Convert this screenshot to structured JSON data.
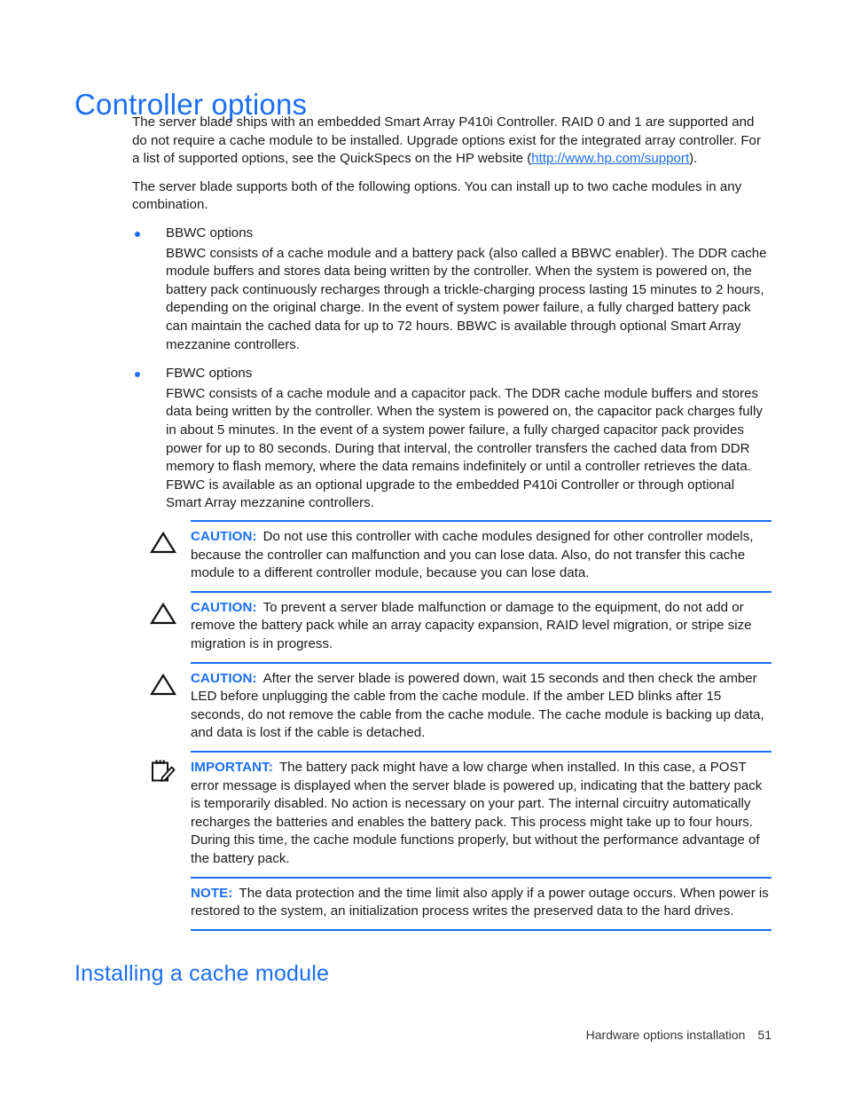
{
  "page": {
    "accent_blue": "#1a6ef5",
    "text_color": "#1a1a1a"
  },
  "heading": {
    "title": "Controller options",
    "subsection": "Installing a cache module"
  },
  "intro": {
    "paragraph1_before_link": "The server blade ships with an embedded Smart Array P410i Controller. RAID 0 and 1 are supported and do not require a cache module to be installed. Upgrade options exist for the integrated array controller. For a list of supported options, see the QuickSpecs on the HP website (",
    "link_text": "http://www.hp.com/support",
    "paragraph1_after_link": ").",
    "paragraph2": "The server blade supports both of the following options. You can install up to two cache modules in any combination."
  },
  "bullets": [
    {
      "label": "BBWC options",
      "body": "BBWC consists of a cache module and a battery pack (also called a BBWC enabler). The DDR cache module buffers and stores data being written by the controller. When the system is powered on, the battery pack continuously recharges through a trickle-charging process lasting 15 minutes to 2 hours, depending on the original charge. In the event of system power failure, a fully charged battery pack can maintain the cached data for up to 72 hours. BBWC is available through optional Smart Array mezzanine controllers."
    },
    {
      "label": "FBWC options",
      "body": "FBWC consists of a cache module and a capacitor pack. The DDR cache module buffers and stores data being written by the controller. When the system is powered on, the capacitor pack charges fully in about 5 minutes. In the event of a system power failure, a fully charged capacitor pack provides power for up to 80 seconds. During that interval, the controller transfers the cached data from DDR memory to flash memory, where the data remains indefinitely or until a controller retrieves the data. FBWC is available as an optional upgrade to the embedded P410i Controller or through optional Smart Array mezzanine controllers."
    }
  ],
  "admonitions": [
    {
      "icon": "warning-triangle-icon",
      "label": "CAUTION:",
      "text": "Do not use this controller with cache modules designed for other controller models, because the controller can malfunction and you can lose data. Also, do not transfer this cache module to a different controller module, because you can lose data."
    },
    {
      "icon": "warning-triangle-icon",
      "label": "CAUTION:",
      "text": "To prevent a server blade malfunction or damage to the equipment, do not add or remove the battery pack while an array capacity expansion, RAID level migration, or stripe size migration is in progress."
    },
    {
      "icon": "warning-triangle-icon",
      "label": "CAUTION:",
      "text": "After the server blade is powered down, wait 15 seconds and then check the amber LED before unplugging the cable from the cache module. If the amber LED blinks after 15 seconds, do not remove the cable from the cache module. The cache module is backing up data, and data is lost if the cable is detached."
    },
    {
      "icon": "notepad-pencil-icon",
      "label": "IMPORTANT:",
      "text": "The battery pack might have a low charge when installed. In this case, a POST error message is displayed when the server blade is powered up, indicating that the battery pack is temporarily disabled. No action is necessary on your part. The internal circuitry automatically recharges the batteries and enables the battery pack. This process might take up to four hours. During this time, the cache module functions properly, but without the performance advantage of the battery pack."
    },
    {
      "icon": "none",
      "label": "NOTE:",
      "text": "The data protection and the time limit also apply if a power outage occurs. When power is restored to the system, an initialization process writes the preserved data to the hard drives."
    }
  ],
  "footer": {
    "chapter": "Hardware options installation",
    "page_number": "51"
  }
}
